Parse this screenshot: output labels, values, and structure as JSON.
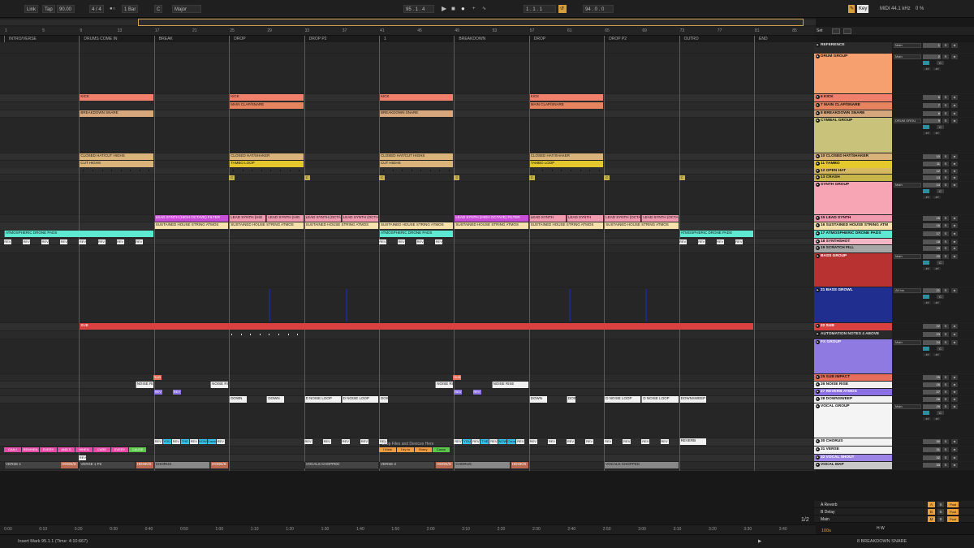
{
  "transport": {
    "link": "Link",
    "tap": "Tap",
    "tempo": "90.00",
    "sig": "4 / 4",
    "metro": "●○",
    "quant": "1 Bar",
    "key_root": "C",
    "key_scale": "Major",
    "position": "95 .   1 .   4",
    "loop_start": "1 .   1 .   1",
    "loop_len": "94 .   0 .   0",
    "key_btn": "Key",
    "midi": "MIDI",
    "rate": "44.1 kHz",
    "cpu": "0 %"
  },
  "ruler": [
    "1",
    "5",
    "9",
    "13",
    "17",
    "21",
    "25",
    "29",
    "33",
    "37",
    "41",
    "45",
    "49",
    "53",
    "57",
    "61",
    "65",
    "69",
    "73",
    "77",
    "81",
    "85"
  ],
  "locators": [
    "INTRO/VERSE",
    "DRUMS COME IN",
    "BREAK",
    "DROP",
    "DROP P2",
    "1",
    "BREAKDOWN",
    "DROP",
    "DROP P2",
    "OUTRO",
    "END"
  ],
  "time_ruler": [
    "0:00",
    "0:10",
    "0:20",
    "0:30",
    "0:40",
    "0:50",
    "1:00",
    "1:10",
    "1:20",
    "1:30",
    "1:40",
    "1:50",
    "2:00",
    "2:10",
    "2:20",
    "2:30",
    "2:40",
    "2:50",
    "3:00",
    "3:10",
    "3:20",
    "3:30",
    "3:40"
  ],
  "tracks": [
    {
      "name": "REFERENCE",
      "color": "#2a2a2a",
      "text": "#ddd",
      "num": "1",
      "route": "Main"
    },
    {
      "name": "DRUM GROUP",
      "color": "#f5a06e",
      "num": "2",
      "route": "Main"
    },
    {
      "name": "6 KICK",
      "color": "#f07f6b",
      "num": "6"
    },
    {
      "name": "7 MAIN CLAP/SNARE",
      "color": "#e5845e",
      "num": "7"
    },
    {
      "name": "8 BREAKDOWN SNARE",
      "color": "#d6a77d",
      "num": "8"
    },
    {
      "name": "CYMBAL GROUP",
      "color": "#c9c27a",
      "num": "9",
      "route": "DRUM GROU"
    },
    {
      "name": "10 CLOSED HAT/SHAKER",
      "color": "#d9b37a",
      "num": "10"
    },
    {
      "name": "11 TAMBO",
      "color": "#e4c82c",
      "num": "11"
    },
    {
      "name": "12 OPEN HAT",
      "color": "#d6b861",
      "num": "12"
    },
    {
      "name": "13 CRASH",
      "color": "#c7b54a",
      "num": "13"
    },
    {
      "name": "SYNTH GROUP",
      "color": "#f7a5b4",
      "num": "14",
      "route": "Main"
    },
    {
      "name": "15 LEAD SYNTH",
      "color": "#f29ab0",
      "num": "15"
    },
    {
      "name": "16 SUSTAINED HOUSE STRING ATM",
      "color": "#f6e1ad",
      "num": "16"
    },
    {
      "name": "17 ATMOSPHERIC DRONE PADS",
      "color": "#5ee8d2",
      "num": "17"
    },
    {
      "name": "18 SYNTHSHOT",
      "color": "#f2b6c4",
      "num": "18"
    },
    {
      "name": "19 SCRATCH FILL",
      "color": "#a7a7a7",
      "num": "19"
    },
    {
      "name": "BASS GROUP",
      "color": "#b83232",
      "text": "#fff",
      "num": "20",
      "route": "Main"
    },
    {
      "name": "21 BASS GROWL",
      "color": "#1f2e8f",
      "text": "#fff",
      "num": "21",
      "route": "All Ins"
    },
    {
      "name": "22 SUB",
      "color": "#d94040",
      "text": "#fff",
      "num": "22"
    },
    {
      "name": "AUTOMATION NOTES 4 ABOVE",
      "color": "#2a2a2a",
      "text": "#ddd",
      "num": "23"
    },
    {
      "name": "FX GROUP",
      "color": "#8e7ae0",
      "text": "#fff",
      "num": "24",
      "route": "Main"
    },
    {
      "name": "25 SUB IMPACT",
      "color": "#e76e5a",
      "num": "25"
    },
    {
      "name": "26 NOISE RISE",
      "color": "#f0f0f0",
      "num": "26"
    },
    {
      "name": "27 REVERB ATMOS",
      "color": "#8b70e3",
      "text": "#fff",
      "num": "27"
    },
    {
      "name": "28 DOWNSWEEP",
      "color": "#f2f2f2",
      "num": "28"
    },
    {
      "name": "VOCAL GROUP",
      "color": "#f4f4f4",
      "num": "29",
      "route": "Main"
    },
    {
      "name": "30 CHORUS",
      "color": "#f2f2f2",
      "num": "30"
    },
    {
      "name": "31 VERSE",
      "color": "#f2f2f2",
      "num": "31"
    },
    {
      "name": "32 VOCAL SHOUT",
      "color": "#9b84e6",
      "text": "#fff",
      "num": "32"
    },
    {
      "name": "VOCAL MAP",
      "color": "#c8c8c8",
      "num": "33"
    }
  ],
  "clips": {
    "kick": "KICK",
    "clap": "MAIN CLAP/SNARE",
    "bsnare": "BREAKDOWN SNARE",
    "hat": "CLOSED HAT/CUT HIGHS",
    "hat2": "CLOSED HAT/SHAKER",
    "cut": "CUT HIGHS",
    "tambo": "TAMBO LOOP",
    "lead1": "LEAD SYNTH (HIGH OCTAVE) FILTER",
    "lead2": "LEAD SYNTH (HIG",
    "lead3": "LEAD SYNTH (OCTA",
    "lead4": "LEAD SYNTH",
    "strings": "SUSTAINED HOUSE STRING ATMOS",
    "pads": "ATMOSPHERIC DRONE PADS",
    "rev": "REV",
    "sub": "SUB",
    "noise": "NOISE RISE",
    "down": "DOWNSWEEP",
    "downshort": "DOWN",
    "dnoise": "D NOISE LOOP",
    "verse1": "VERSE 1",
    "hook": "HOOK/S",
    "verse1p2": "VERSE 1 P2",
    "chorus": "CHORUS",
    "vchop": "VOCALS CHOPPED",
    "verse2": "VERSE 2",
    "v_can": "CAN I",
    "v_rewhen": "REWHEN",
    "v_every": "EVERY",
    "v_and": "AND S",
    "v_when": "WHEN",
    "v_care": "CARE",
    "v_cause": "CAUSE",
    "c_rev": "REV",
    "c_you": "YOU",
    "c_the": "THE",
    "c_now": "NOW",
    "c_think": "I think",
    "c_tryto": "I try to",
    "c_everyw": "Every",
    "c_cause": "Cause",
    "c_reverb": "REVERB"
  },
  "drop_hint": "Drop Files and Devices Here",
  "setbar": {
    "set": "Set"
  },
  "returns": [
    {
      "name": "A Reverb",
      "letter": "A"
    },
    {
      "name": "B Delay",
      "letter": "B"
    },
    {
      "name": "Main",
      "letter": "M"
    }
  ],
  "return_buttons": {
    "post": "Post",
    "s": "S",
    "m": "M",
    "solo": "S",
    "c": "C",
    "route_main": "1/2",
    "zero": "0",
    "one": "1"
  },
  "mixer": {
    "s": "S",
    "c": "C",
    "minus": "-inf",
    "zero": "0",
    "all_ch": "All Channe",
    "in": "In",
    "auto": "Auto",
    "off": "Off",
    "bass_grou": "BASS GROU",
    "page": "1/2",
    "hw": "H W"
  },
  "status": {
    "insert": "Insert Mark 95.1.1 (Time: 4:10:667)",
    "track": "8 BREAKDOWN SNARE",
    "zoom": "100s"
  }
}
